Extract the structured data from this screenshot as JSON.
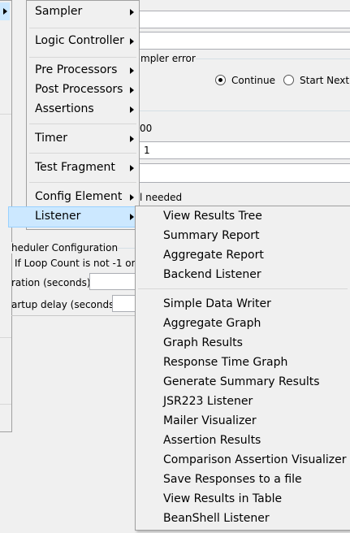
{
  "background_panel": {
    "sampler_error_label": "mpler error",
    "continue_label": "Continue",
    "start_next_label": "Start Next T",
    "threads_value": "00",
    "rampup_value": "1",
    "needed_label": "l needed",
    "scheduler_config_label": "heduler Configuration",
    "loop_count_label": "If Loop Count is not -1 or",
    "duration_label": "ration (seconds)",
    "startup_delay_label": "artup delay (seconds)"
  },
  "add_menu": {
    "items": [
      {
        "label": "Sampler"
      },
      {
        "label": "Logic Controller"
      },
      {
        "label": "Pre Processors"
      },
      {
        "label": "Post Processors"
      },
      {
        "label": "Assertions"
      },
      {
        "label": "Timer"
      },
      {
        "label": "Test Fragment"
      },
      {
        "label": "Config Element"
      },
      {
        "label": "Listener"
      }
    ]
  },
  "listener_menu": {
    "items": [
      {
        "label": "View Results Tree"
      },
      {
        "label": "Summary Report"
      },
      {
        "label": "Aggregate Report"
      },
      {
        "label": "Backend Listener"
      },
      {
        "label": "Simple Data Writer"
      },
      {
        "label": "Aggregate Graph"
      },
      {
        "label": "Graph Results"
      },
      {
        "label": "Response Time Graph"
      },
      {
        "label": "Generate Summary Results"
      },
      {
        "label": "JSR223 Listener"
      },
      {
        "label": "Mailer Visualizer"
      },
      {
        "label": "Assertion Results"
      },
      {
        "label": "Comparison Assertion Visualizer"
      },
      {
        "label": "Save Responses to a file"
      },
      {
        "label": "View Results in Table"
      },
      {
        "label": "BeanShell Listener"
      }
    ]
  }
}
